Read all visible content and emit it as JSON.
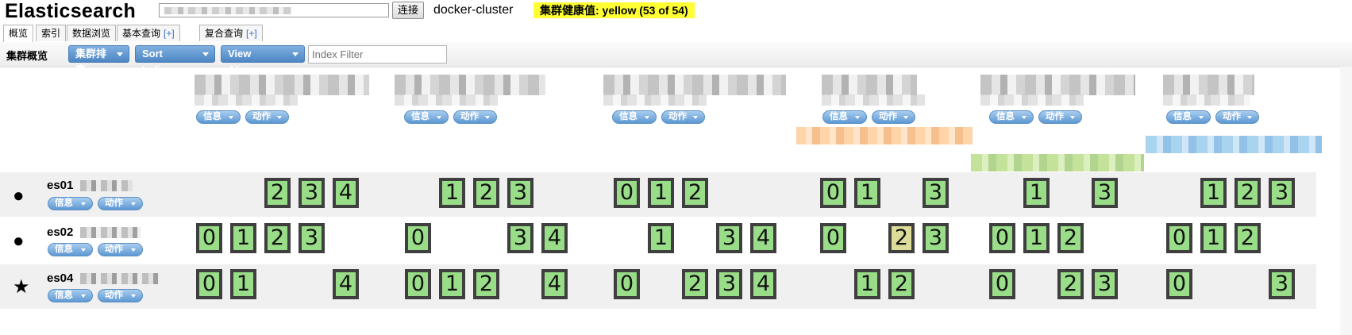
{
  "header": {
    "app_title": "Elasticsearch",
    "connect_label": "连接",
    "cluster_name": "docker-cluster",
    "health_label": "集群健康值: yellow (53 of 54)",
    "health_color": "#ffff33"
  },
  "tabs": [
    {
      "label": "概览",
      "active": true
    },
    {
      "label": "索引"
    },
    {
      "label": "数据浏览"
    },
    {
      "label": "基本查询",
      "plus": "[+]"
    },
    {
      "label": "复合查询",
      "plus": "[+]"
    }
  ],
  "toolbar": {
    "overview_label": "集群概览",
    "sort_cluster_label": "集群排序",
    "sort_indices_label": "Sort Indices",
    "view_aliases_label": "View Aliases",
    "index_filter_placeholder": "Index Filter"
  },
  "menus": {
    "info_label": "信息",
    "action_label": "动作"
  },
  "nodes": [
    {
      "name": "es01",
      "marker": "●",
      "marker_icon": "circle-icon",
      "shards": [
        [
          "2",
          "3",
          "4"
        ],
        [
          "1",
          "2",
          "3"
        ],
        [
          "0",
          "1",
          "2"
        ],
        [
          "0",
          "1",
          "3"
        ],
        [
          "1",
          "3"
        ],
        [
          "1",
          "2",
          "3"
        ]
      ]
    },
    {
      "name": "es02",
      "marker": "●",
      "marker_icon": "circle-icon",
      "shards": [
        [
          "0",
          "1",
          "2",
          "3"
        ],
        [
          "0",
          "3",
          "4"
        ],
        [
          "1",
          "3",
          "4"
        ],
        [
          "0",
          "2",
          "3"
        ],
        [
          "0",
          "1",
          "2"
        ],
        [
          "0",
          "1",
          "2"
        ]
      ]
    },
    {
      "name": "es04",
      "marker": "★",
      "marker_icon": "star-icon",
      "shards": [
        [
          "0",
          "1",
          "4"
        ],
        [
          "0",
          "1",
          "2",
          "4"
        ],
        [
          "0",
          "2",
          "3",
          "4"
        ],
        [
          "1",
          "2"
        ],
        [
          "0",
          "2",
          "3"
        ],
        [
          "0",
          "3"
        ]
      ]
    }
  ],
  "colors": {
    "shard_assigned": "#99dd88",
    "shard_unassigned_replica": "#dddd99",
    "button_blue": "#4d86c4"
  }
}
